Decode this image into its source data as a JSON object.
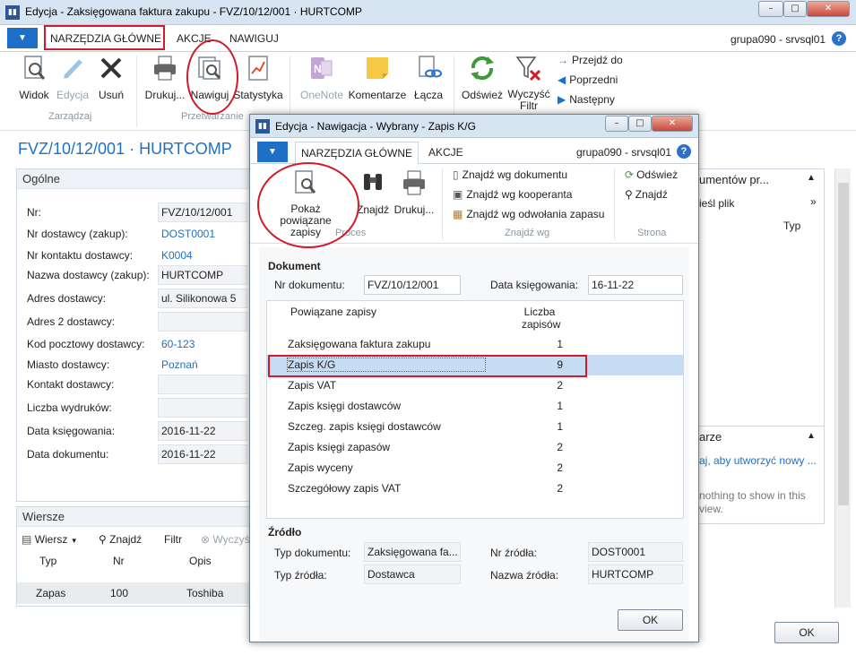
{
  "main_window": {
    "title": "Edycja - Zaksięgowana faktura zakupu - FVZ/10/12/001 · HURTCOMP",
    "app_icon": "dynamics-nav-icon",
    "controls": {
      "minimize": "–",
      "maximize": "□",
      "close": "✕"
    }
  },
  "ribbon_tabs": {
    "file_arrow": "▼",
    "home": "NARZĘDZIA GŁÓWNE",
    "actions": "AKCJE",
    "navigate": "NAWIGUJ"
  },
  "account": {
    "user": "grupa090 - srvsql01",
    "help": "?"
  },
  "ribbon": {
    "groups": {
      "manage": "Zarządzaj",
      "process": "Przetwarzanie"
    },
    "buttons": {
      "view": "Widok",
      "edit": "Edycja",
      "delete": "Usuń",
      "print": "Drukuj...",
      "navigate": "Nawiguj",
      "statistics": "Statystyka",
      "onenote": "OneNote",
      "notes": "Komentarze",
      "links": "Łącza",
      "refresh": "Odśwież",
      "clear_filter_line1": "Wyczyść",
      "clear_filter_line2": "Filtr"
    },
    "nav": {
      "goto": "Przejdź do",
      "previous": "Poprzedni",
      "next": "Następny"
    }
  },
  "page": {
    "title": "FVZ/10/12/001 · HURTCOMP",
    "general": {
      "header": "Ogólne",
      "fields": [
        {
          "label": "Nr:",
          "value": "FVZ/10/12/001"
        },
        {
          "label": "Nr dostawcy (zakup):",
          "value": "DOST0001"
        },
        {
          "label": "Nr kontaktu dostawcy:",
          "value": "K0004"
        },
        {
          "label": "Nazwa dostawcy (zakup):",
          "value": "HURTCOMP"
        },
        {
          "label": "Adres dostawcy:",
          "value": "ul. Silikonowa 5"
        },
        {
          "label": "Adres 2 dostawcy:",
          "value": ""
        },
        {
          "label": "Kod pocztowy dostawcy:",
          "value": "60-123"
        },
        {
          "label": "Miasto dostawcy:",
          "value": "Poznań"
        },
        {
          "label": "Kontakt dostawcy:",
          "value": ""
        },
        {
          "label": "Liczba wydruków:",
          "value": ""
        },
        {
          "label": "Data księgowania:",
          "value": "2016-11-22"
        },
        {
          "label": "Data dokumentu:",
          "value": "2016-11-22"
        }
      ]
    },
    "lines": {
      "header": "Wiersze",
      "toolbar": {
        "line": "Wiersz",
        "find": "Znajdź",
        "filter": "Filtr",
        "clear": "Wyczyść"
      },
      "columns": [
        "Typ",
        "Nr",
        "Opis"
      ],
      "rows": [
        {
          "type": "Zapas",
          "no": "100",
          "desc": "Toshiba"
        }
      ]
    },
    "factbox": {
      "documents_header": "umentów pr...",
      "file_link": "ieśl plik",
      "col_type": "Typ",
      "notes_header": "arze",
      "notes_link": "aj, aby utworzyć nowy ...",
      "nothing": "nothing to show in this view."
    },
    "ok": "OK"
  },
  "dialog": {
    "title": "Edycja - Nawigacja - Wybrany - Zapis K/G",
    "tabs": {
      "home": "NARZĘDZIA GŁÓWNE",
      "actions": "AKCJE"
    },
    "account": "grupa090 - srvsql01",
    "ribbon": {
      "show_related_line1": "Pokaż",
      "show_related_line2": "powiązane zapisy",
      "find": "Znajdź",
      "print": "Drukuj...",
      "find_by_document": "Znajdź wg dokumentu",
      "find_by_contact": "Znajdź wg kooperanta",
      "find_by_item_ref": "Znajdź wg odwołania zapasu",
      "refresh": "Odśwież",
      "find2": "Znajdź",
      "groups": {
        "process": "Proces",
        "find_by": "Znajdź wg",
        "page": "Strona"
      }
    },
    "document": {
      "header": "Dokument",
      "doc_no_label": "Nr dokumentu:",
      "doc_no": "FVZ/10/12/001",
      "posting_date_label": "Data księgowania:",
      "posting_date": "16-11-22"
    },
    "entries": {
      "col_related": "Powiązane zapisy",
      "col_count_line1": "Liczba",
      "col_count_line2": "zapisów",
      "rows": [
        {
          "name": "Zaksięgowana faktura zakupu",
          "count": "1"
        },
        {
          "name": "Zapis K/G",
          "count": "9"
        },
        {
          "name": "Zapis VAT",
          "count": "2"
        },
        {
          "name": "Zapis księgi dostawców",
          "count": "1"
        },
        {
          "name": "Szczeg. zapis księgi dostawców",
          "count": "1"
        },
        {
          "name": "Zapis księgi zapasów",
          "count": "2"
        },
        {
          "name": "Zapis wyceny",
          "count": "2"
        },
        {
          "name": "Szczegółowy zapis VAT",
          "count": "2"
        }
      ]
    },
    "source": {
      "header": "Źródło",
      "doc_type_label": "Typ dokumentu:",
      "doc_type": "Zaksięgowana fa...",
      "source_no_label": "Nr źródła:",
      "source_no": "DOST0001",
      "source_type_label": "Typ źródła:",
      "source_type": "Dostawca",
      "source_name_label": "Nazwa źródła:",
      "source_name": "HURTCOMP"
    },
    "ok": "OK"
  },
  "colors": {
    "accent": "#1e6fc6",
    "highlight": "#c5dcf2",
    "annotation": "#d11b2a"
  }
}
